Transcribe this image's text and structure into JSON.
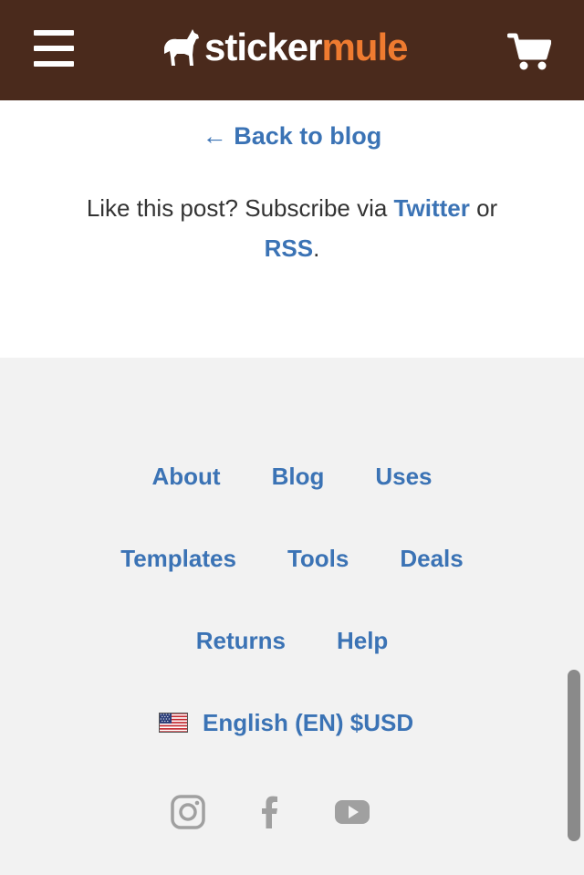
{
  "header": {
    "logo": {
      "sticker": "sticker",
      "mule": "mule"
    },
    "colors": {
      "background": "#4a2a1c",
      "accent": "#ef7b30"
    },
    "menu_icon": "hamburger-menu-icon",
    "cart_icon": "shopping-cart-icon"
  },
  "content": {
    "back_link": "← Back to blog",
    "subscribe_prefix": "Like this post? Subscribe via ",
    "twitter_label": "Twitter",
    "subscribe_or": " or ",
    "rss_label": "RSS",
    "subscribe_suffix": "."
  },
  "footer": {
    "links_row1": {
      "about": "About",
      "blog": "Blog",
      "uses": "Uses"
    },
    "links_row2": {
      "templates": "Templates",
      "tools": "Tools",
      "deals": "Deals"
    },
    "links_row3": {
      "returns": "Returns",
      "help": "Help"
    },
    "language": "English (EN) $USD",
    "flag_icon": "us-flag-icon",
    "social_icons": [
      "instagram-icon",
      "facebook-icon",
      "youtube-icon"
    ],
    "colors": {
      "link": "#3b73b5",
      "icon": "#a0a0a0"
    }
  }
}
